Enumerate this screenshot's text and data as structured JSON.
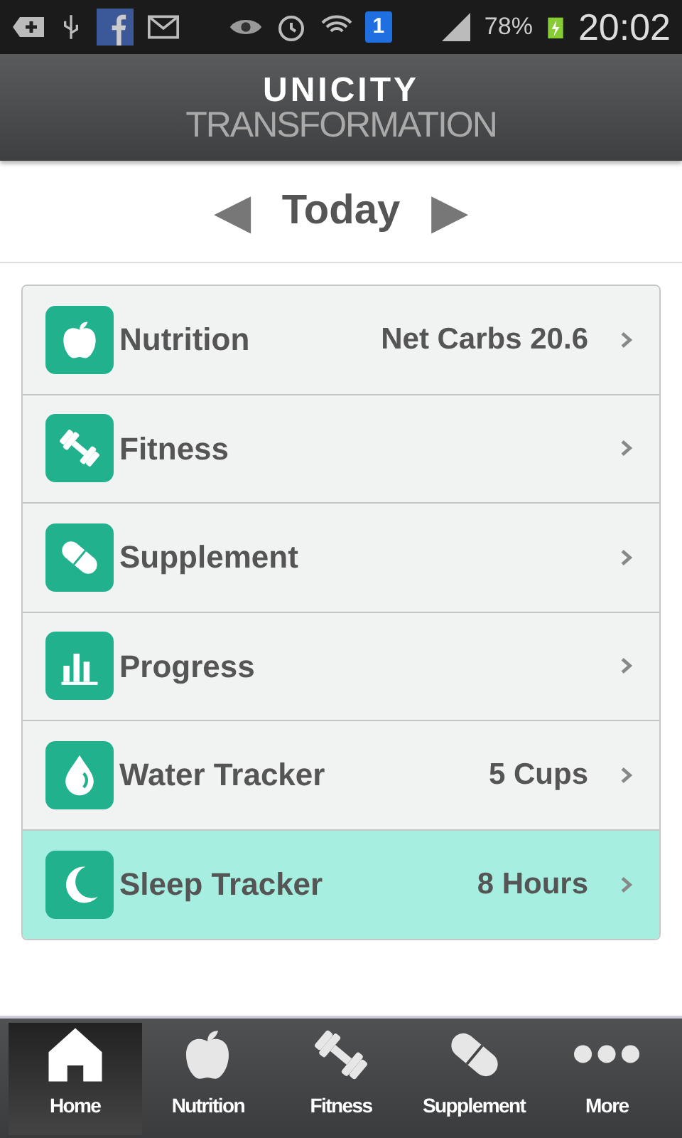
{
  "status_bar": {
    "sim": "1",
    "battery": "78%",
    "time": "20:02"
  },
  "header": {
    "logo_top": "UNICITY",
    "logo_bottom": "TRANSFORMATION"
  },
  "date_nav": {
    "prev": "◀",
    "label": "Today",
    "next": "▶"
  },
  "menu": [
    {
      "label": "Nutrition",
      "value": "Net Carbs 20.6",
      "selected": false
    },
    {
      "label": "Fitness",
      "selected": false
    },
    {
      "label": "Supplement",
      "selected": false
    },
    {
      "label": "Progress",
      "selected": false
    },
    {
      "label": "Water Tracker",
      "value": "5 Cups",
      "selected": false
    },
    {
      "label": "Sleep Tracker",
      "value": "8 Hours",
      "selected": true
    }
  ],
  "tab_bar": [
    {
      "label": "Home",
      "selected": true
    },
    {
      "label": "Nutrition",
      "selected": false
    },
    {
      "label": "Fitness",
      "selected": false
    },
    {
      "label": "Supplement",
      "selected": false
    },
    {
      "label": "More",
      "selected": false
    }
  ]
}
